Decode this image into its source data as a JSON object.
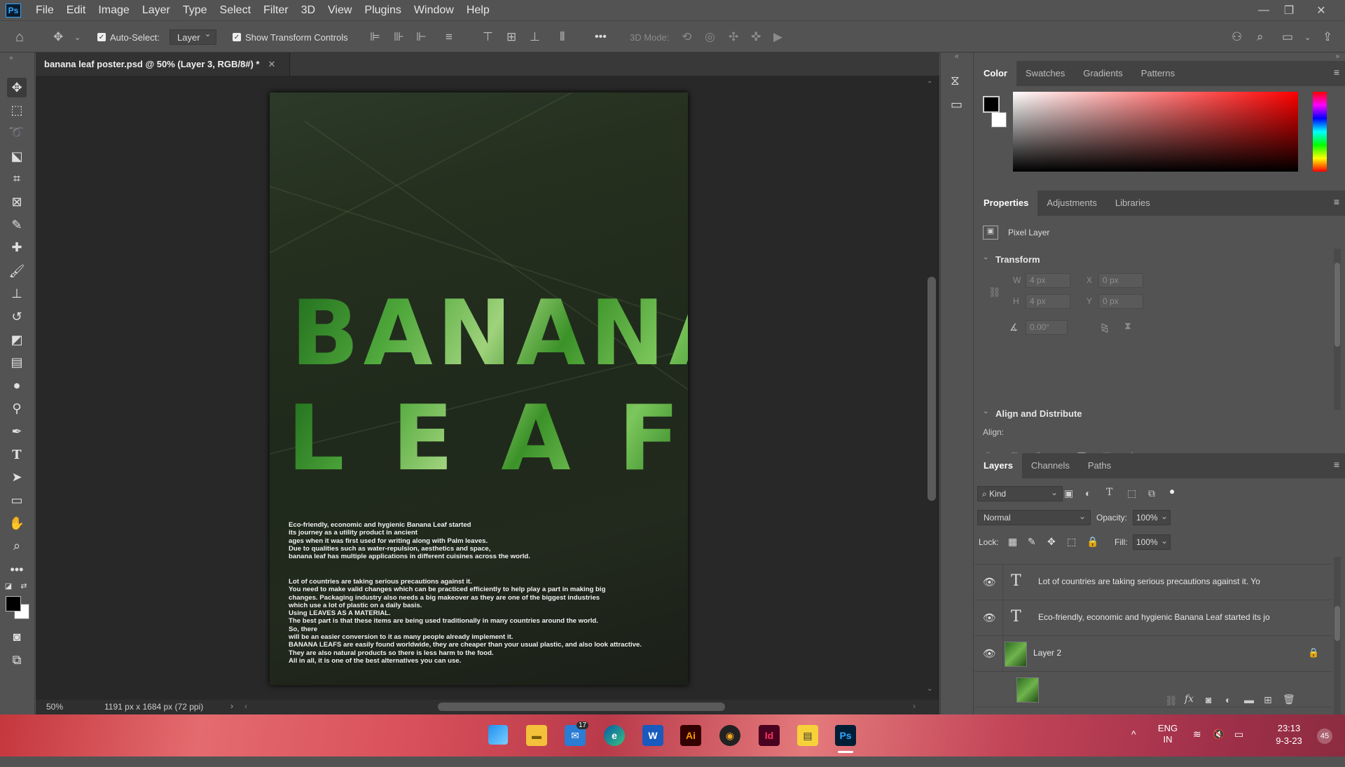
{
  "app": {
    "logo": "Ps"
  },
  "menu": [
    "File",
    "Edit",
    "Image",
    "Layer",
    "Type",
    "Select",
    "Filter",
    "3D",
    "View",
    "Plugins",
    "Window",
    "Help"
  ],
  "options_bar": {
    "auto_select_label": "Auto-Select:",
    "auto_select_value": "Layer",
    "show_transform_label": "Show Transform Controls",
    "more": "•••",
    "mode_3d_label": "3D Mode:"
  },
  "document": {
    "tab_title": "banana leaf poster.psd @ 50% (Layer 3, RGB/8#) *",
    "zoom": "50%",
    "doc_info": "1191 px x 1684 px (72 ppi)"
  },
  "poster": {
    "title_line1": "BANANA",
    "title_line2": [
      "L",
      "E",
      "A",
      "F"
    ],
    "paragraph1": "Eco-friendly, economic and hygienic Banana Leaf started\nits journey as a utility product in ancient\nages when it was first used for writing along with Palm leaves.\nDue to qualities such as water-repulsion, aesthetics and space,\nbanana leaf has multiple applications in different cuisines across the world.",
    "paragraph2": "Lot of countries are taking serious precautions against it.\nYou need to make valid changes which can be practiced efficiently to help play a part in making big\nchanges. Packaging industry also needs a big makeover as they are one of the biggest industries\nwhich use a lot of plastic on a daily basis.\nUsing LEAVES AS A MATERIAL.\nThe best part is that these items are being used traditionally in many countries around the world.\nSo, there\nwill be an easier conversion to it as many people already implement it.\nBANANA LEAFS are easily found worldwide, they are cheaper than your usual plastic, and also look attractive.\nThey are also natural products so there is less harm to the food.\nAll in all, it is one of the best alternatives you can use."
  },
  "color_panel": {
    "tabs": [
      "Color",
      "Swatches",
      "Gradients",
      "Patterns"
    ]
  },
  "properties_panel": {
    "tabs": [
      "Properties",
      "Adjustments",
      "Libraries"
    ],
    "layer_type": "Pixel Layer",
    "transform_title": "Transform",
    "w_label": "W",
    "w_value": "4 px",
    "h_label": "H",
    "h_value": "4 px",
    "x_label": "X",
    "x_value": "0 px",
    "y_label": "Y",
    "y_value": "0 px",
    "angle_value": "0.00°",
    "align_title": "Align and Distribute",
    "align_label": "Align:"
  },
  "layers_panel": {
    "tabs": [
      "Layers",
      "Channels",
      "Paths"
    ],
    "kind_label": "Kind",
    "blend_mode": "Normal",
    "opacity_label": "Opacity:",
    "opacity_value": "100%",
    "lock_label": "Lock:",
    "fill_label": "Fill:",
    "fill_value": "100%",
    "layers": [
      {
        "type": "text",
        "name": "Lot of countries are taking serious precautions against it.  Yo"
      },
      {
        "type": "text",
        "name": "Eco-friendly, economic and hygienic Banana Leaf started  its jo"
      },
      {
        "type": "pixel",
        "name": "Layer 2",
        "locked": true
      }
    ]
  },
  "taskbar": {
    "mail_badge": "17",
    "lang_line1": "ENG",
    "lang_line2": "IN",
    "time": "23:13",
    "date": "9-3-23",
    "notification_count": "45",
    "apps": [
      "Ai",
      "Id",
      "Ps",
      "W"
    ]
  },
  "colors": {
    "accent": "#31a8ff",
    "panel": "#535353",
    "canvas_bg": "#282828"
  }
}
